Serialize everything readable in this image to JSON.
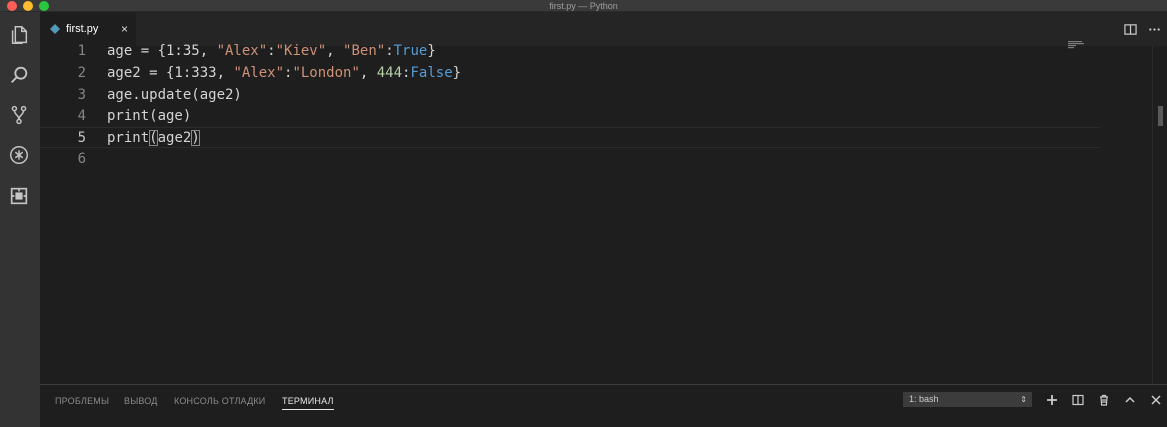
{
  "window": {
    "title": "first.py — Python"
  },
  "activity_bar": [
    {
      "name": "explorer-icon"
    },
    {
      "name": "search-icon"
    },
    {
      "name": "source-control-icon"
    },
    {
      "name": "debug-icon"
    },
    {
      "name": "extensions-icon"
    }
  ],
  "tabs": [
    {
      "label": "first.py",
      "icon": "python-file-icon",
      "close": "×"
    }
  ],
  "editor": {
    "lines": [
      {
        "number": "1"
      },
      {
        "number": "2"
      },
      {
        "number": "3"
      },
      {
        "number": "4"
      },
      {
        "number": "5"
      },
      {
        "number": "6"
      }
    ]
  },
  "panel": {
    "tabs": [
      "ПРОБЛЕМЫ",
      "ВЫВОД",
      "КОНСОЛЬ ОТЛАДКИ",
      "ТЕРМИНАЛ"
    ],
    "active_tab": "ТЕРМИНАЛ",
    "terminal_select": "1: bash",
    "actions": [
      "add-terminal-icon",
      "split-terminal-icon",
      "trash-icon",
      "maximize-panel-icon",
      "close-panel-icon"
    ]
  },
  "colors": {
    "string": "#ce9178",
    "number": "#b5cea8",
    "keyword": "#569cd6",
    "text": "#d4d4d4"
  }
}
